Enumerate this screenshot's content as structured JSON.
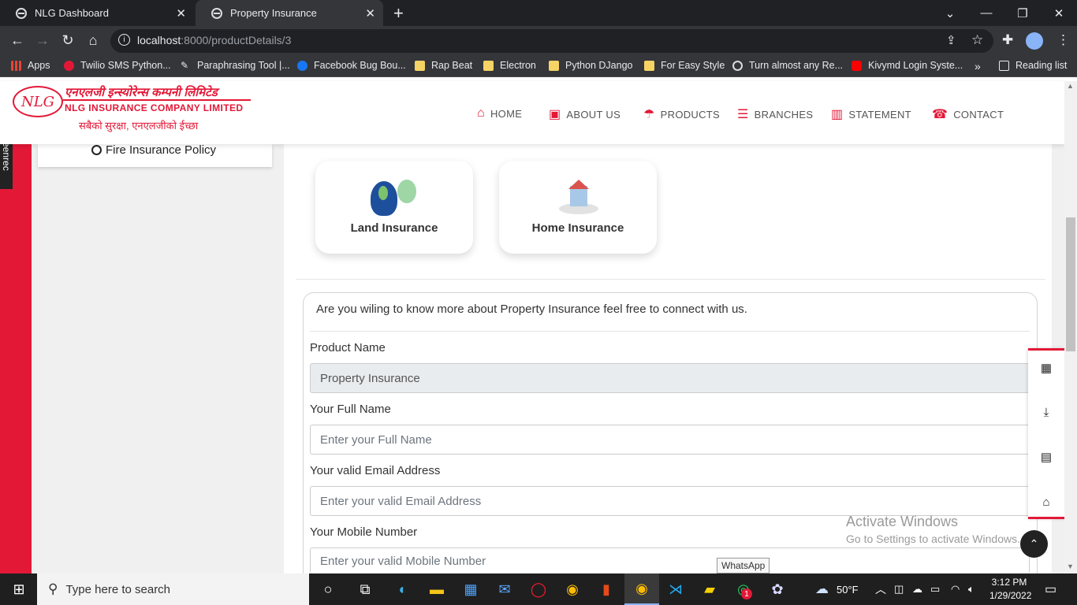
{
  "browser": {
    "tabs": [
      {
        "title": "NLG Dashboard",
        "active": false
      },
      {
        "title": "Property Insurance",
        "active": true
      }
    ],
    "new_tab": "+",
    "url_host": "localhost",
    "url_path": ":8000/productDetails/3",
    "bookmarks": [
      "Apps",
      "Twilio SMS Python...",
      "Paraphrasing Tool |...",
      "Facebook Bug Bou...",
      "Rap Beat",
      "Electron",
      "Python DJango",
      "For Easy Style",
      "Turn almost any Re...",
      "Kivymd Login Syste..."
    ],
    "bookmarks_more": "»",
    "reading_list": "Reading list"
  },
  "extension_badge": "screenrec",
  "site": {
    "logo_mark": "NLG",
    "company_nepali": "एनएलजी इन्स्योरेन्स कम्पनी लिमिटेड",
    "company_english": "NLG INSURANCE COMPANY LIMITED",
    "tagline": "सबैको सुरक्षा, एनएलजीको ईच्छा",
    "nav": [
      "HOME",
      "ABOUT US",
      "PRODUCTS",
      "BRANCHES",
      "STATEMENT",
      "CONTACT"
    ]
  },
  "sidebar": {
    "policy_item": "Fire Insurance Policy"
  },
  "cards": [
    "Land Insurance",
    "Home Insurance"
  ],
  "form": {
    "intro": "Are you wiling to know more about Property Insurance feel free to connect with us.",
    "product_label": "Product Name",
    "product_value": "Property Insurance",
    "name_label": "Your Full Name",
    "name_placeholder": "Enter your Full Name",
    "email_label": "Your valid Email Address",
    "email_placeholder": "Enter your valid Email Address",
    "mobile_label": "Your Mobile Number",
    "mobile_placeholder": "Enter your valid Mobile Number"
  },
  "watermark": {
    "title": "Activate Windows",
    "subtitle": "Go to Settings to activate Windows."
  },
  "tooltip": "WhatsApp",
  "taskbar": {
    "search_placeholder": "Type here to search",
    "weather": "50°F",
    "time": "3:12 PM",
    "date": "1/29/2022",
    "whatsapp_badge": "1"
  },
  "colors": {
    "brand_red": "#e31837",
    "chrome_dark": "#202124"
  }
}
